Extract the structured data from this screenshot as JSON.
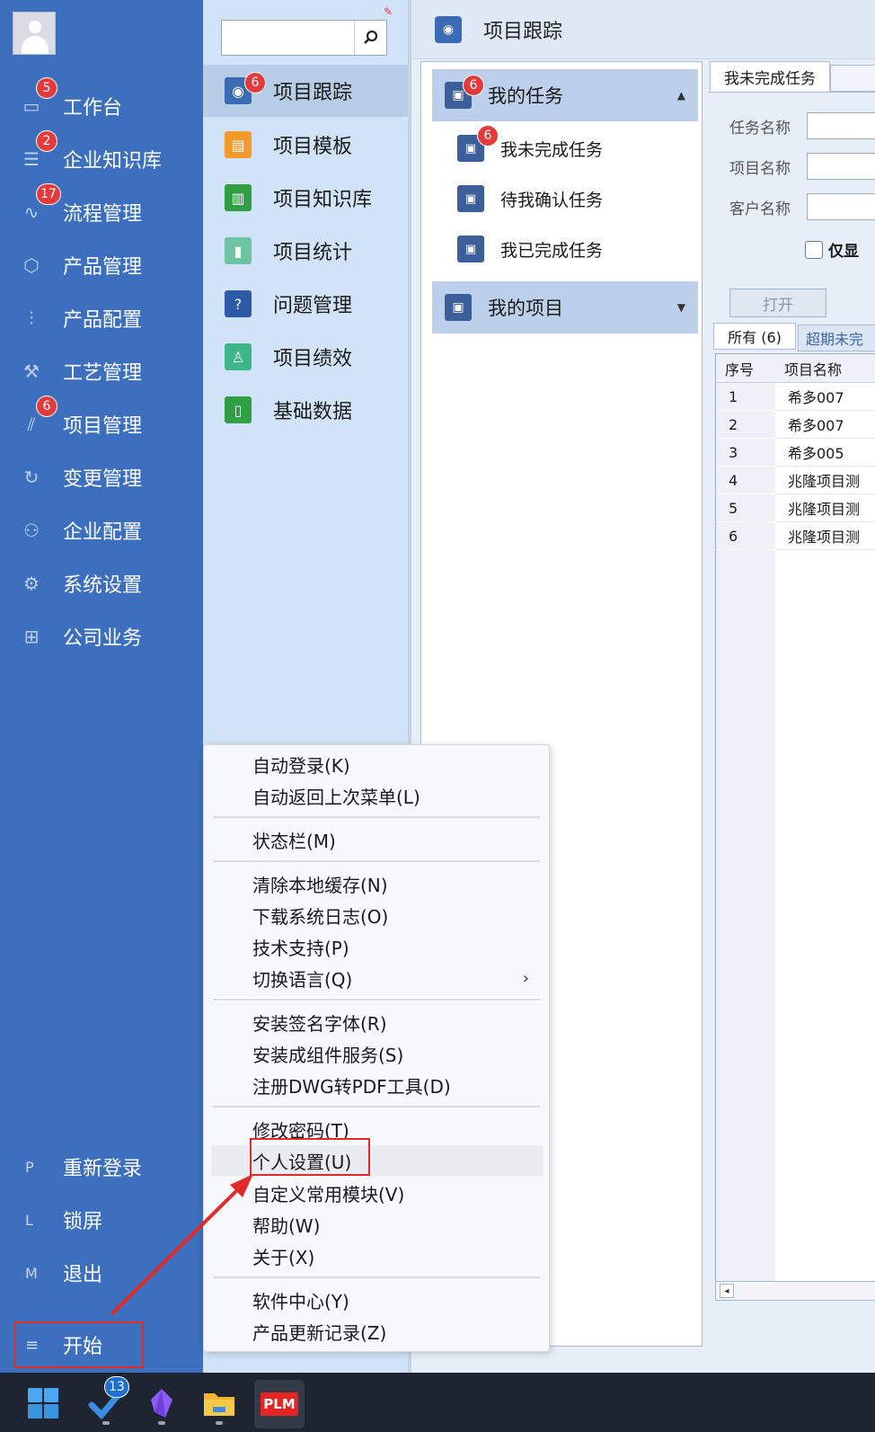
{
  "sidebar": {
    "items": [
      {
        "label": "工作台",
        "icon": "monitor-icon",
        "badge": "5"
      },
      {
        "label": "企业知识库",
        "icon": "book-list-icon",
        "badge": "2"
      },
      {
        "label": "流程管理",
        "icon": "flow-chart-icon",
        "badge": "17"
      },
      {
        "label": "产品管理",
        "icon": "cube-icon",
        "badge": ""
      },
      {
        "label": "产品配置",
        "icon": "sliders-icon",
        "badge": ""
      },
      {
        "label": "工艺管理",
        "icon": "wrench-icon",
        "badge": ""
      },
      {
        "label": "项目管理",
        "icon": "project-chart-icon",
        "badge": "6"
      },
      {
        "label": "变更管理",
        "icon": "change-cycle-icon",
        "badge": ""
      },
      {
        "label": "企业配置",
        "icon": "users-icon",
        "badge": ""
      },
      {
        "label": "系统设置",
        "icon": "gear-icon",
        "badge": ""
      },
      {
        "label": "公司业务",
        "icon": "grid-icon",
        "badge": ""
      }
    ],
    "bottom": [
      {
        "key": "P",
        "label": "重新登录"
      },
      {
        "key": "L",
        "label": "锁屏"
      },
      {
        "key": "M",
        "label": "退出"
      }
    ],
    "start": {
      "label": "开始",
      "icon": "hamburger-icon"
    }
  },
  "modules": {
    "search_placeholder": "",
    "items": [
      {
        "label": "项目跟踪",
        "icon": "location-pin-icon",
        "badge": "6",
        "color": "#3c6bb5",
        "active": true
      },
      {
        "label": "项目模板",
        "icon": "template-icon",
        "badge": "",
        "color": "#f29a2e"
      },
      {
        "label": "项目知识库",
        "icon": "knowledge-book-icon",
        "badge": "",
        "color": "#2f9e44"
      },
      {
        "label": "项目统计",
        "icon": "bar-stats-icon",
        "badge": "",
        "color": "#6cc4a4"
      },
      {
        "label": "问题管理",
        "icon": "question-icon",
        "badge": "",
        "color": "#2f5aa8"
      },
      {
        "label": "项目绩效",
        "icon": "person-performance-icon",
        "badge": "",
        "color": "#3fb58a"
      },
      {
        "label": "基础数据",
        "icon": "open-book-icon",
        "badge": "",
        "color": "#2f9e44"
      }
    ]
  },
  "main": {
    "title": "项目跟踪",
    "tree": {
      "my_tasks": {
        "label": "我的任务",
        "badge": "6"
      },
      "leaves": [
        {
          "label": "我未完成任务",
          "badge": "6"
        },
        {
          "label": "待我确认任务",
          "badge": ""
        },
        {
          "label": "我已完成任务",
          "badge": ""
        }
      ],
      "my_projects": {
        "label": "我的项目"
      }
    },
    "detail": {
      "tab": "我未完成任务",
      "fields": [
        {
          "label": "任务名称",
          "value": ""
        },
        {
          "label": "项目名称",
          "value": ""
        },
        {
          "label": "客户名称",
          "value": ""
        }
      ],
      "only_check": "仅显",
      "open_button": "打开",
      "sub_tabs": {
        "all": "所有 (6)",
        "overdue": "超期未完"
      },
      "grid": {
        "headers": [
          "序号",
          "项目名称"
        ],
        "rows": [
          [
            "1",
            "希多007"
          ],
          [
            "2",
            "希多007"
          ],
          [
            "3",
            "希多005"
          ],
          [
            "4",
            "兆隆项目测"
          ],
          [
            "5",
            "兆隆项目测"
          ],
          [
            "6",
            "兆隆项目测"
          ]
        ]
      }
    }
  },
  "context_menu": {
    "items": [
      "自动登录(K)",
      "自动返回上次菜单(L)",
      "状态栏(M)",
      "清除本地缓存(N)",
      "下载系统日志(O)",
      "技术支持(P)",
      "切换语言(Q)",
      "安装签名字体(R)",
      "安装成组件服务(S)",
      "注册DWG转PDF工具(D)",
      "修改密码(T)",
      "个人设置(U)",
      "自定义常用模块(V)",
      "帮助(W)",
      "关于(X)",
      "软件中心(Y)",
      "产品更新记录(Z)"
    ]
  },
  "taskbar": {
    "todo_badge": "13",
    "plm_label": "PLM"
  },
  "colors": {
    "sidebar": "#3d6fbf",
    "accent_red": "#e12b2b",
    "badge": "#e33b3b"
  }
}
